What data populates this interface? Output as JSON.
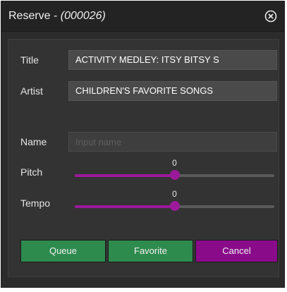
{
  "dialog": {
    "title_prefix": "Reserve - ",
    "title_code": "(000026)",
    "close_icon": "close-circle-icon"
  },
  "form": {
    "title_label": "Title",
    "title_value": "ACTIVITY MEDLEY: ITSY BITSY S",
    "artist_label": "Artist",
    "artist_value": "CHILDREN'S FAVORITE SONGS",
    "name_label": "Name",
    "name_placeholder": "Input name",
    "name_value": "",
    "pitch_label": "Pitch",
    "pitch_value": "0",
    "pitch_fraction": 0.5,
    "tempo_label": "Tempo",
    "tempo_value": "0",
    "tempo_fraction": 0.5
  },
  "buttons": {
    "queue": "Queue",
    "favorite": "Favorite",
    "cancel": "Cancel"
  },
  "colors": {
    "accent_purple": "#9b1a9b",
    "button_green": "#2e8b4e",
    "button_purple": "#8a0b8a"
  }
}
